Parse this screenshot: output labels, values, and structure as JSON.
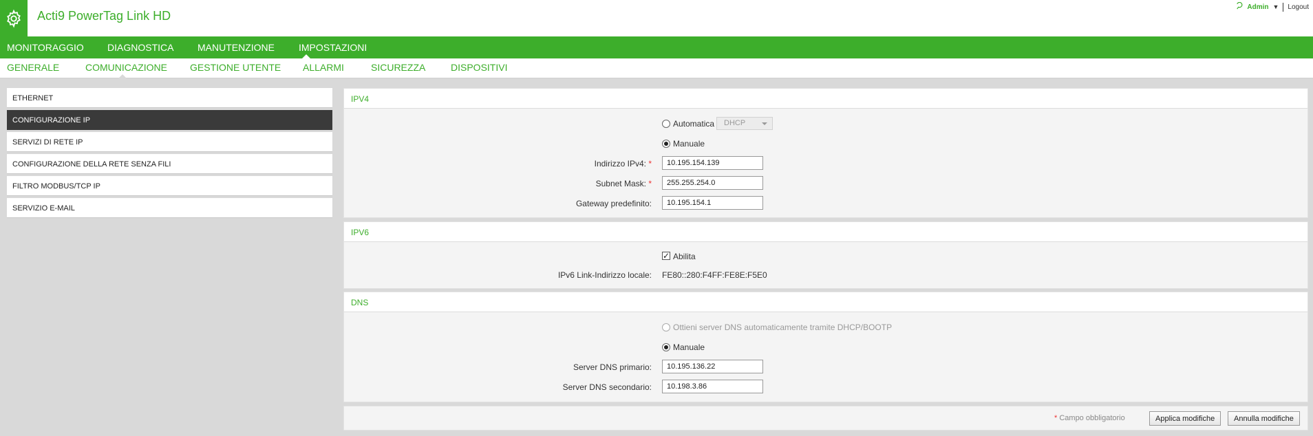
{
  "header": {
    "app_title": "Acti9 PowerTag Link HD",
    "user": "Admin",
    "logout": "Logout"
  },
  "main_nav": {
    "items": [
      "MONITORAGGIO",
      "DIAGNOSTICA",
      "MANUTENZIONE",
      "IMPOSTAZIONI"
    ],
    "active": "IMPOSTAZIONI"
  },
  "sub_nav": {
    "items": [
      "GENERALE",
      "COMUNICAZIONE",
      "GESTIONE UTENTE",
      "ALLARMI",
      "SICUREZZA",
      "DISPOSITIVI"
    ],
    "active": "COMUNICAZIONE"
  },
  "sidebar": {
    "items": [
      {
        "label": "ETHERNET"
      },
      {
        "label": "CONFIGURAZIONE IP"
      },
      {
        "label": "SERVIZI DI RETE IP"
      },
      {
        "label": "CONFIGURAZIONE DELLA RETE SENZA FILI"
      },
      {
        "label": "FILTRO MODBUS/TCP IP"
      },
      {
        "label": "SERVIZIO E-MAIL"
      }
    ],
    "active": "CONFIGURAZIONE IP"
  },
  "ipv4": {
    "title": "IPV4",
    "auto_label": "Automatica",
    "auto_select": "DHCP",
    "manual_label": "Manuale",
    "address_label": "Indirizzo IPv4:",
    "address_value": "10.195.154.139",
    "mask_label": "Subnet Mask:",
    "mask_value": "255.255.254.0",
    "gateway_label": "Gateway predefinito:",
    "gateway_value": "10.195.154.1"
  },
  "ipv6": {
    "title": "IPV6",
    "enable_label": "Abilita",
    "local_label": "IPv6 Link-Indirizzo locale:",
    "local_value": "FE80::280:F4FF:FE8E:F5E0"
  },
  "dns": {
    "title": "DNS",
    "auto_label": "Ottieni server DNS automaticamente tramite DHCP/BOOTP",
    "manual_label": "Manuale",
    "primary_label": "Server DNS primario:",
    "primary_value": "10.195.136.22",
    "secondary_label": "Server DNS secondario:",
    "secondary_value": "10.198.3.86"
  },
  "footer": {
    "required_star": "*",
    "required_note": "Campo obbligatorio",
    "apply": "Applica modifiche",
    "cancel": "Annulla modifiche"
  },
  "colors": {
    "brand_green": "#3dae2b",
    "active_dark": "#3a3a3a",
    "required_red": "#ee3333"
  }
}
